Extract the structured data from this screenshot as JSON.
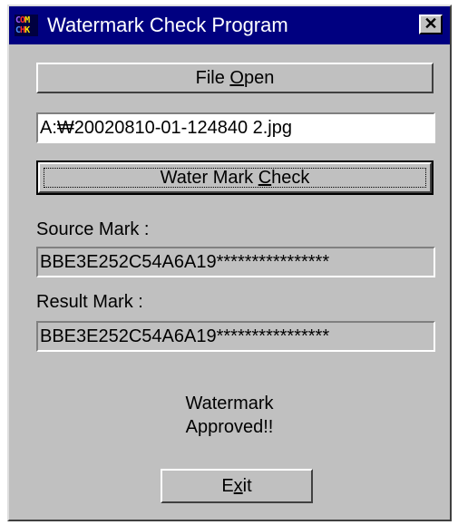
{
  "window": {
    "title": "Watermark Check Program",
    "icon_top": [
      "C",
      "O",
      "M"
    ],
    "icon_bottom": [
      "C",
      "H",
      "K"
    ],
    "close_icon_glyph": "✕"
  },
  "file_open_button": {
    "label_before": "File ",
    "label_mnemonic": "O",
    "label_after": "pen"
  },
  "file_path": {
    "value": "A:₩20020810-01-124840 2.jpg"
  },
  "watermark_check_button": {
    "label_before": "Water Mark ",
    "label_mnemonic": "C",
    "label_after": "heck"
  },
  "source_mark": {
    "label": "Source Mark :",
    "value": "BBE3E252C54A6A19****************"
  },
  "result_mark": {
    "label": "Result Mark  :",
    "value": "BBE3E252C54A6A19****************"
  },
  "status": {
    "line1": "Watermark",
    "line2": "Approved!!"
  },
  "exit_button": {
    "label_before": "E",
    "label_mnemonic": "x",
    "label_after": "it"
  },
  "colors": {
    "titlebar": "#000080",
    "face": "#c0c0c0",
    "field": "#ffffff"
  }
}
